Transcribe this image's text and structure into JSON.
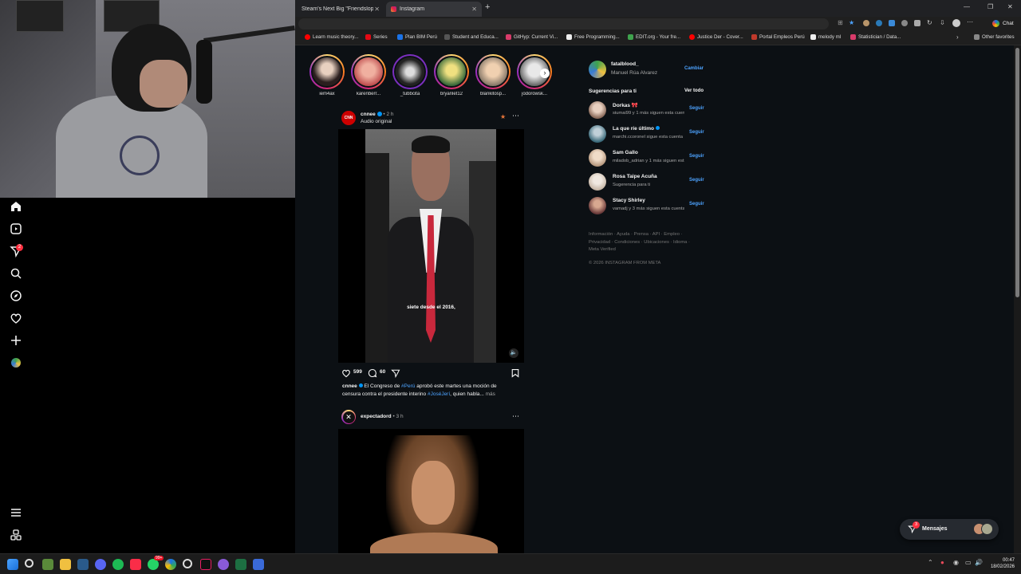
{
  "browser": {
    "tabs": [
      {
        "label": "Steam's Next Big \"Friendslop\" Hit"
      },
      {
        "label": "Instagram"
      }
    ],
    "new_tab": "+",
    "chat_label": "Chat",
    "bookmarks": [
      "Learn music theory...",
      "Series",
      "Plan BIM Perú",
      "Student and Educa...",
      "GitHyp: Current Vi...",
      "Free Programming...",
      "EDIT.org - Your fre...",
      "Justice Der - Cover...",
      "Portal Empleos Perú",
      "melody ml",
      "Statistician / Data..."
    ],
    "other_favorites": "Other favorites"
  },
  "stories": [
    {
      "label": "iem4ax"
    },
    {
      "label": "karenberr..."
    },
    {
      "label": "_tubbcita"
    },
    {
      "label": "bryanlet12"
    },
    {
      "label": "blankitosp..."
    },
    {
      "label": "jodorowsk..."
    }
  ],
  "post1": {
    "user": "cnnee",
    "time": "• 2 h",
    "audio": "Audio original",
    "avatar_text": "CNN",
    "video_caption": "siete desde el 2016,",
    "likes": "599",
    "comments": "60",
    "caption_user": "cnnee",
    "caption_part1": "El Congreso de",
    "caption_tag1": "#Perú",
    "caption_part2": "aprobó este martes una moción de",
    "caption_line2a": "censura contra el presidente interino",
    "caption_tag2": "#JoséJerí",
    "caption_line2b": ", quien habla...",
    "more": "más"
  },
  "post2": {
    "user": "expectadord",
    "time": "• 3 h"
  },
  "profile": {
    "username": "fatalblood_",
    "name": "Manuel Rúa Alvarez",
    "switch": "Cambiar"
  },
  "suggestions": {
    "title": "Sugerencias para ti",
    "see_all": "Ver todo",
    "follow": "Seguir",
    "items": [
      {
        "name": "Dorkas 🎀",
        "sub": "siumai99 y 1 más siguen esta cuenta",
        "color": "#8a6a5a"
      },
      {
        "name": "La que ríe último",
        "sub": "marchi.ccoronel sigue esta cuenta",
        "color": "#3b6a7a"
      },
      {
        "name": "Sam Gallo",
        "sub": "miladob_adrian y 1 más siguen esta cuenta",
        "color": "#b89a80"
      },
      {
        "name": "Rosa Taipe Acuña",
        "sub": "Sugerencia para ti",
        "color": "#c8b8a8"
      },
      {
        "name": "Stacy Shirley",
        "sub": "vamadj y 3 más siguen esta cuenta",
        "color": "#6a3a3a"
      }
    ]
  },
  "footer": {
    "line1": "Información · Ayuda · Prensa · API · Empleo ·",
    "line2": "Privacidad · Condiciones · Ubicaciones · Idioma ·",
    "line3": "Meta Verified",
    "copyright": "© 2026 INSTAGRAM FROM META"
  },
  "messages": {
    "label": "Mensajes",
    "badge": "3"
  },
  "notifications_badge": "2",
  "clock": {
    "time": "00:47",
    "date": "18/02/2026"
  },
  "taskbar_badge": "99+"
}
